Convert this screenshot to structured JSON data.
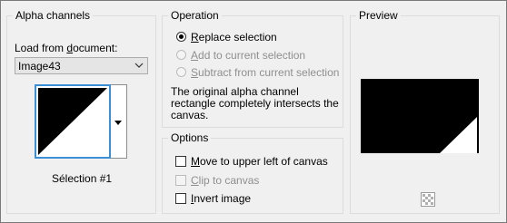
{
  "alpha": {
    "title": "Alpha channels",
    "load_label_pre": "Load from ",
    "load_label_mn": "d",
    "load_label_post": "ocument:",
    "document_value": "Image43",
    "selection_name": "Sélection #1"
  },
  "operation": {
    "title": "Operation",
    "options": [
      {
        "mn": "R",
        "rest": "eplace selection",
        "checked": true,
        "enabled": true
      },
      {
        "mn": "A",
        "rest": "dd to current selection",
        "checked": false,
        "enabled": false
      },
      {
        "mn": "S",
        "rest": "ubtract from current selection",
        "checked": false,
        "enabled": false
      }
    ],
    "note_lines": [
      "The original alpha channel",
      "rectangle completely intersects the",
      "canvas."
    ]
  },
  "options": {
    "title": "Options",
    "checks": [
      {
        "mn": "M",
        "rest": "ove to upper left of canvas",
        "checked": false,
        "enabled": true
      },
      {
        "mn": "C",
        "rest": "lip to canvas",
        "checked": false,
        "enabled": false
      },
      {
        "mn": "I",
        "rest": "nvert image",
        "checked": false,
        "enabled": true
      }
    ]
  },
  "preview": {
    "title": "Preview",
    "icon": "checkerboard-icon"
  }
}
